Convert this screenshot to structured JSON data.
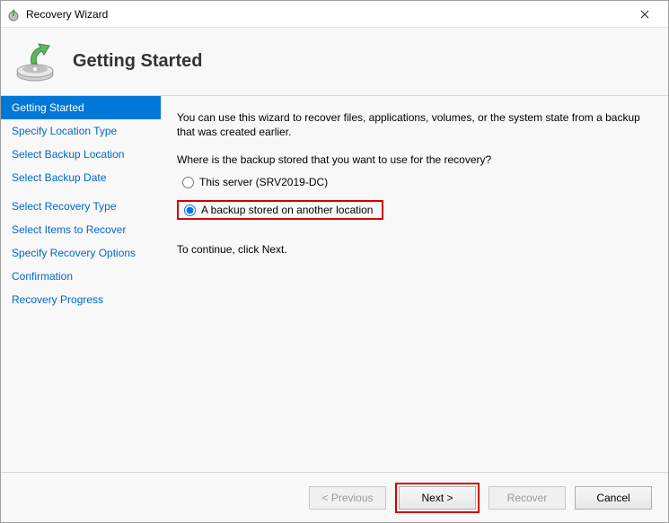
{
  "window": {
    "title": "Recovery Wizard"
  },
  "header": {
    "page_title": "Getting Started"
  },
  "sidebar": {
    "items": [
      {
        "label": "Getting Started",
        "selected": true
      },
      {
        "label": "Specify Location Type",
        "selected": false
      },
      {
        "label": "Select Backup Location",
        "selected": false
      },
      {
        "label": "Select Backup Date",
        "selected": false
      },
      {
        "label": "Select Recovery Type",
        "selected": false
      },
      {
        "label": "Select Items to Recover",
        "selected": false
      },
      {
        "label": "Specify Recovery Options",
        "selected": false
      },
      {
        "label": "Confirmation",
        "selected": false
      },
      {
        "label": "Recovery Progress",
        "selected": false
      }
    ]
  },
  "content": {
    "intro": "You can use this wizard to recover files, applications, volumes, or the system state from a backup that was created earlier.",
    "question": "Where is the backup stored that you want to use for the recovery?",
    "option_this_server": "This server (SRV2019-DC)",
    "option_another_location": "A backup stored on another location",
    "continue_hint": "To continue, click Next."
  },
  "footer": {
    "previous": "< Previous",
    "next": "Next >",
    "recover": "Recover",
    "cancel": "Cancel"
  }
}
